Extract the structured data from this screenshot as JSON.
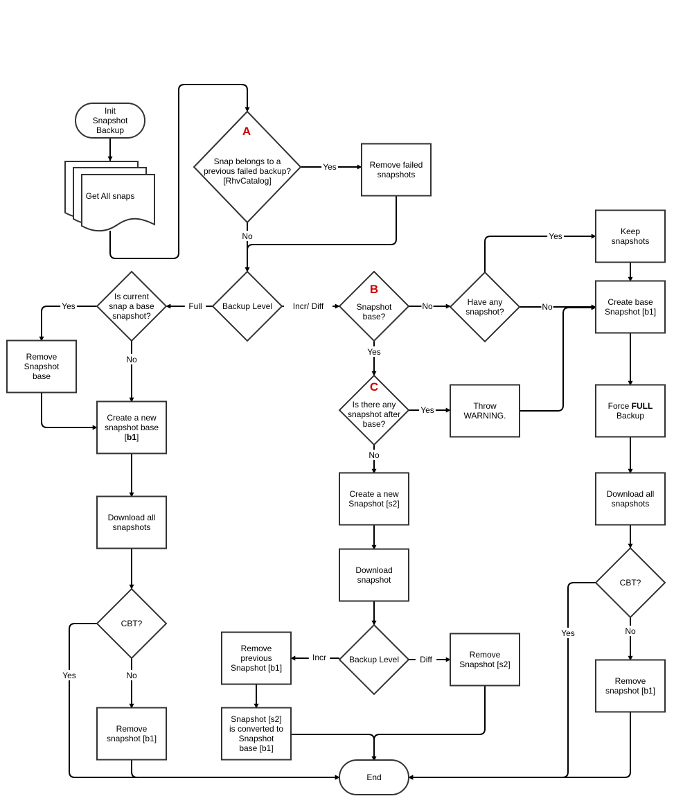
{
  "colors": {
    "stroke": "#333333",
    "tag": "#cc0000",
    "background": "#ffffff"
  },
  "nodes": {
    "init": {
      "lines": [
        [
          "Init"
        ],
        [
          "Snapshot"
        ],
        [
          "Backup"
        ]
      ]
    },
    "getall": {
      "lines": [
        [
          "Get All snaps"
        ]
      ]
    },
    "decA": {
      "tag": "A",
      "lines": [
        [
          "Snap belongs to a"
        ],
        [
          "previous failed backup?"
        ],
        [
          "[RhvCatalog]"
        ]
      ]
    },
    "remfail": {
      "lines": [
        [
          "Remove failed"
        ],
        [
          "snapshots"
        ]
      ]
    },
    "bl1": {
      "lines": [
        [
          "Backup Level"
        ]
      ]
    },
    "iscur": {
      "lines": [
        [
          "Is current"
        ],
        [
          "snap a base"
        ],
        [
          "snapshot?"
        ]
      ]
    },
    "remsb": {
      "lines": [
        [
          "Remove"
        ],
        [
          "Snapshot"
        ],
        [
          "base"
        ]
      ]
    },
    "cnew": {
      "lines": [
        [
          "Create a new"
        ],
        [
          "snapshot base"
        ],
        [
          "[",
          "b1",
          "]"
        ]
      ]
    },
    "dl1": {
      "lines": [
        [
          "Download all"
        ],
        [
          "snapshots"
        ]
      ]
    },
    "cbt1": {
      "lines": [
        [
          "CBT?"
        ]
      ]
    },
    "rem1": {
      "lines": [
        [
          "Remove"
        ],
        [
          "snapshot [b1]"
        ]
      ]
    },
    "decB": {
      "tag": "B",
      "lines": [
        [
          "Snapshot"
        ],
        [
          "base?"
        ]
      ]
    },
    "have": {
      "lines": [
        [
          "Have any"
        ],
        [
          "snapshot?"
        ]
      ]
    },
    "keep": {
      "lines": [
        [
          "Keep"
        ],
        [
          "snapshots"
        ]
      ]
    },
    "cbase": {
      "lines": [
        [
          "Create base"
        ],
        [
          "Snapshot [b1]"
        ]
      ]
    },
    "force": {
      "lines": [
        [
          "Force ",
          "FULL"
        ],
        [
          "Backup"
        ]
      ]
    },
    "dl2": {
      "lines": [
        [
          "Download all"
        ],
        [
          "snapshots"
        ]
      ]
    },
    "cbt2": {
      "lines": [
        [
          "CBT?"
        ]
      ]
    },
    "rem2": {
      "lines": [
        [
          "Remove"
        ],
        [
          "snapshot [b1]"
        ]
      ]
    },
    "decC": {
      "tag": "C",
      "lines": [
        [
          "Is there any"
        ],
        [
          "snapshot after"
        ],
        [
          "base?"
        ]
      ]
    },
    "warn": {
      "lines": [
        [
          "Throw"
        ],
        [
          "WARNING."
        ]
      ]
    },
    "cs2": {
      "lines": [
        [
          "Create a new"
        ],
        [
          "Snapshot [s2]"
        ]
      ]
    },
    "dls": {
      "lines": [
        [
          "Download"
        ],
        [
          "snapshot"
        ]
      ]
    },
    "bl2": {
      "lines": [
        [
          "Backup Level"
        ]
      ]
    },
    "remprev": {
      "lines": [
        [
          "Remove"
        ],
        [
          "previous"
        ],
        [
          "Snapshot [b1]"
        ]
      ]
    },
    "s2conv": {
      "lines": [
        [
          "Snapshot [s2]"
        ],
        [
          "is converted to"
        ],
        [
          "Snapshot"
        ],
        [
          "base [b1]"
        ]
      ]
    },
    "rems2": {
      "lines": [
        [
          "Remove"
        ],
        [
          "Snapshot [s2]"
        ]
      ]
    },
    "end": {
      "lines": [
        [
          "End"
        ]
      ]
    }
  },
  "bold_words": [
    "b1",
    "FULL"
  ],
  "edge_labels": [
    "Yes",
    "No",
    "Full",
    "Incr/ Diff",
    "Yes",
    "No",
    "No",
    "Yes",
    "No",
    "Yes",
    "Yes",
    "No",
    "No",
    "Yes",
    "Incr",
    "Diff",
    "Yes",
    "No"
  ]
}
